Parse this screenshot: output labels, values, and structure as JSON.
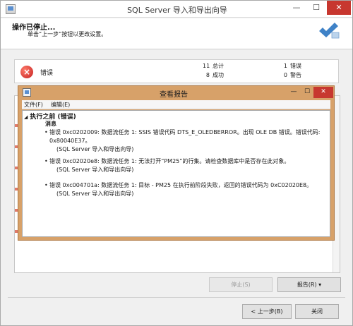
{
  "window": {
    "title": "SQL Server 导入和导出向导",
    "controls": {
      "minimize": "—",
      "maximize": "☐",
      "close": "✕"
    }
  },
  "header": {
    "title": "操作已停止...",
    "subtitle": "单击“上一步”按钮以更改设置。",
    "icon": "wizard-check-icon"
  },
  "summary": {
    "status_icon": "error-x-icon",
    "status": "错误",
    "stats": [
      {
        "count": "11",
        "label": "总计"
      },
      {
        "count": "8",
        "label": "成功"
      },
      {
        "count": "1",
        "label": "错误"
      },
      {
        "count": "0",
        "label": "警告"
      }
    ]
  },
  "report_dialog": {
    "title": "查看报告",
    "menu": [
      "文件(F)",
      "编辑(E)"
    ],
    "section_title": "执行之前 (错误)",
    "subsection": "消息",
    "messages": [
      {
        "text": "错误 0xc0202009: 数据流任务 1: SSIS 错误代码 DTS_E_OLEDBERROR。出现 OLE DB 错误。错误代码: 0x80040E37。",
        "source": "(SQL Server 导入和导出向导)"
      },
      {
        "text": "错误 0xc02020e8: 数据流任务 1: 无法打开“PM25”的行集。请检查数据库中是否存在此对象。",
        "source": "(SQL Server 导入和导出向导)"
      },
      {
        "text": "错误 0xc004701a: 数据流任务 1: 目标 - PM25 在执行前阶段失败，返回的错误代码为 0xC02020E8。",
        "source": "(SQL Server 导入和导出向导)"
      }
    ]
  },
  "buttons": {
    "stop": "停止(S)",
    "report": "报告(R) ▾",
    "back": "< 上一步(B)",
    "close": "关闭"
  },
  "colors": {
    "dialog_frame": "#d7a169",
    "close_button": "#c7372f",
    "error_icon": "#c41f1f"
  }
}
